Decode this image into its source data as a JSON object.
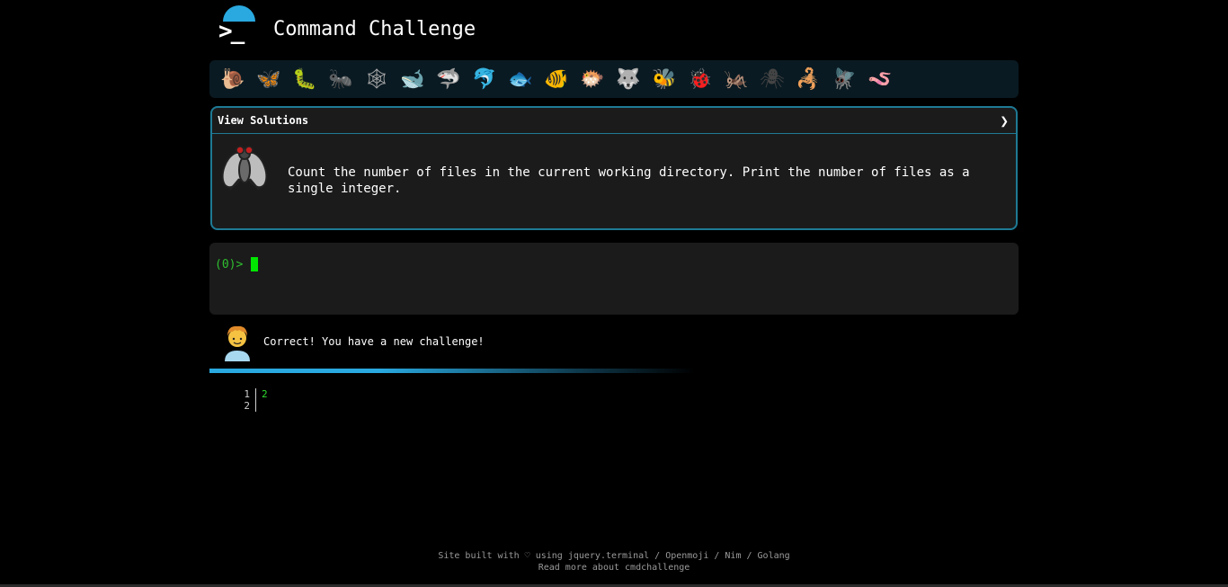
{
  "header": {
    "title": "Command Challenge",
    "logo_prompt": ">_"
  },
  "levels": [
    {
      "icon": "snail-icon",
      "glyph": "🐌",
      "color": "#8a6a4a"
    },
    {
      "icon": "butterfly-icon",
      "glyph": "🦋",
      "color": "#e0902a"
    },
    {
      "icon": "caterpillar-icon",
      "glyph": "🐛",
      "color": "#6ab03a"
    },
    {
      "icon": "ant-icon",
      "glyph": "🐜",
      "color": "#555555"
    },
    {
      "icon": "spider-web-icon",
      "glyph": "🕸",
      "color": "#aaaaaa"
    },
    {
      "icon": "whale-icon",
      "glyph": "🐋",
      "color": "#4a8fc0"
    },
    {
      "icon": "shark-icon",
      "glyph": "🦈",
      "color": "#4a9fd0"
    },
    {
      "icon": "dolphin-icon",
      "glyph": "🐬",
      "color": "#9a9a9a"
    },
    {
      "icon": "fish-icon",
      "glyph": "🐟",
      "color": "#4a9fd0"
    },
    {
      "icon": "tropical-fish-icon",
      "glyph": "🐠",
      "color": "#e0c020"
    },
    {
      "icon": "blowfish-icon",
      "glyph": "🐡",
      "color": "#8a6a4a"
    },
    {
      "icon": "wolf-icon",
      "glyph": "🐺",
      "color": "#888888"
    },
    {
      "icon": "bee-icon",
      "glyph": "🐝",
      "color": "#e0c020"
    },
    {
      "icon": "ladybug-icon",
      "glyph": "🐞",
      "color": "#d02020"
    },
    {
      "icon": "cricket-icon",
      "glyph": "🦗",
      "color": "#3a9a2a"
    },
    {
      "icon": "spider-icon",
      "glyph": "🕷",
      "color": "#444444"
    },
    {
      "icon": "scorpion-icon",
      "glyph": "🦂",
      "color": "#c03020"
    },
    {
      "icon": "fly-icon",
      "glyph": "🪰",
      "color": "#cccccc"
    },
    {
      "icon": "worm-icon",
      "glyph": "🪱",
      "color": "#d070a0"
    }
  ],
  "challenge": {
    "header_label": "View Solutions",
    "chevron": "❯",
    "description": "Count the number of files in the current working directory. Print the number of files as a single integer."
  },
  "terminal": {
    "prompt": "(0)>"
  },
  "result": {
    "message": "Correct! You have a new challenge!"
  },
  "output": {
    "lines": [
      {
        "num": "1",
        "value": "2"
      },
      {
        "num": "2",
        "value": ""
      }
    ]
  },
  "footer": {
    "line1": "Site built with ♡ using jquery.terminal / Openmoji / Nim / Golang",
    "line2": "Read more about cmdchallenge"
  },
  "colors": {
    "accent": "#29a9e0",
    "border": "#1e7a95",
    "prompt_green": "#2fbf2f"
  }
}
